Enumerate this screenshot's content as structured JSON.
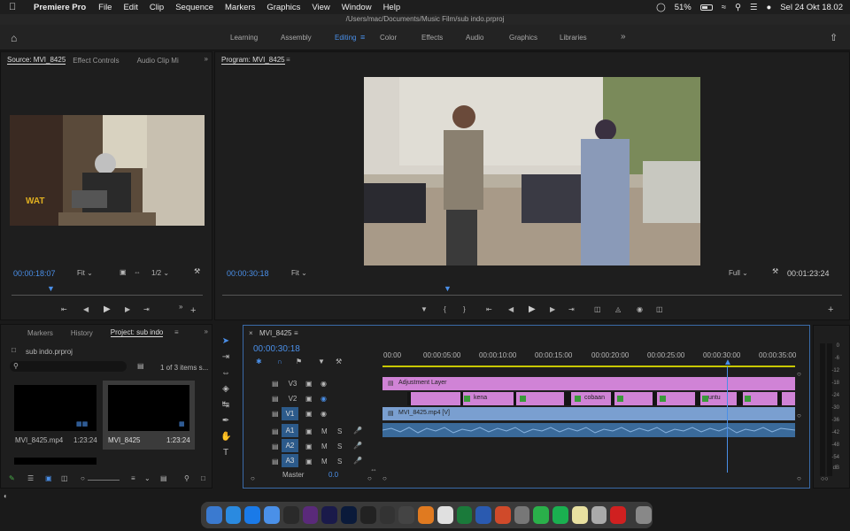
{
  "menubar": {
    "app": "Premiere Pro",
    "items": [
      "File",
      "Edit",
      "Clip",
      "Sequence",
      "Markers",
      "Graphics",
      "View",
      "Window",
      "Help"
    ],
    "battery": "51%",
    "datetime": "Sel 24 Okt  18.02"
  },
  "window": {
    "title": "/Users/mac/Documents/Music Film/sub indo.prproj"
  },
  "workspaces": {
    "items": [
      "Learning",
      "Assembly",
      "Editing",
      "Color",
      "Effects",
      "Audio",
      "Graphics",
      "Libraries"
    ],
    "active": "Editing"
  },
  "source": {
    "tabs": [
      "Source: MVI_8425",
      "Effect Controls",
      "Audio Clip Mi"
    ],
    "timecode": "00:00:18:07",
    "fit": "Fit",
    "resolution": "1/2"
  },
  "program": {
    "tab": "Program: MVI_8425",
    "timecode": "00:00:30:18",
    "fit": "Fit",
    "quality": "Full",
    "duration": "00:01:23:24"
  },
  "project": {
    "tabs": [
      "Markers",
      "History",
      "Project: sub indo"
    ],
    "file": "sub indo.prproj",
    "count": "1 of 3 items s...",
    "items": [
      {
        "name": "MVI_8425.mp4",
        "duration": "1:23:24"
      },
      {
        "name": "MVI_8425",
        "duration": "1:23:24"
      }
    ]
  },
  "timeline": {
    "tab": "MVI_8425",
    "timecode": "00:00:30:18",
    "ruler": [
      "00:00",
      "00:00:05:00",
      "00:00:10:00",
      "00:00:15:00",
      "00:00:20:00",
      "00:00:25:00",
      "00:00:30:00",
      "00:00:35:00"
    ],
    "tracks": {
      "video": [
        "V3",
        "V2",
        "V1"
      ],
      "audio": [
        "A1",
        "A2",
        "A3"
      ],
      "master": "Master",
      "master_value": "0.0"
    },
    "clips": {
      "adjustment": "Adjustment Layer",
      "video": "MVI_8425.mp4 [V]",
      "captions": [
        "kena",
        "cobaan",
        "untu"
      ]
    }
  },
  "meter": {
    "labels": [
      "0",
      "-6",
      "-12",
      "-18",
      "-24",
      "-30",
      "-36",
      "-42",
      "-48",
      "-54"
    ],
    "unit": "dB"
  }
}
